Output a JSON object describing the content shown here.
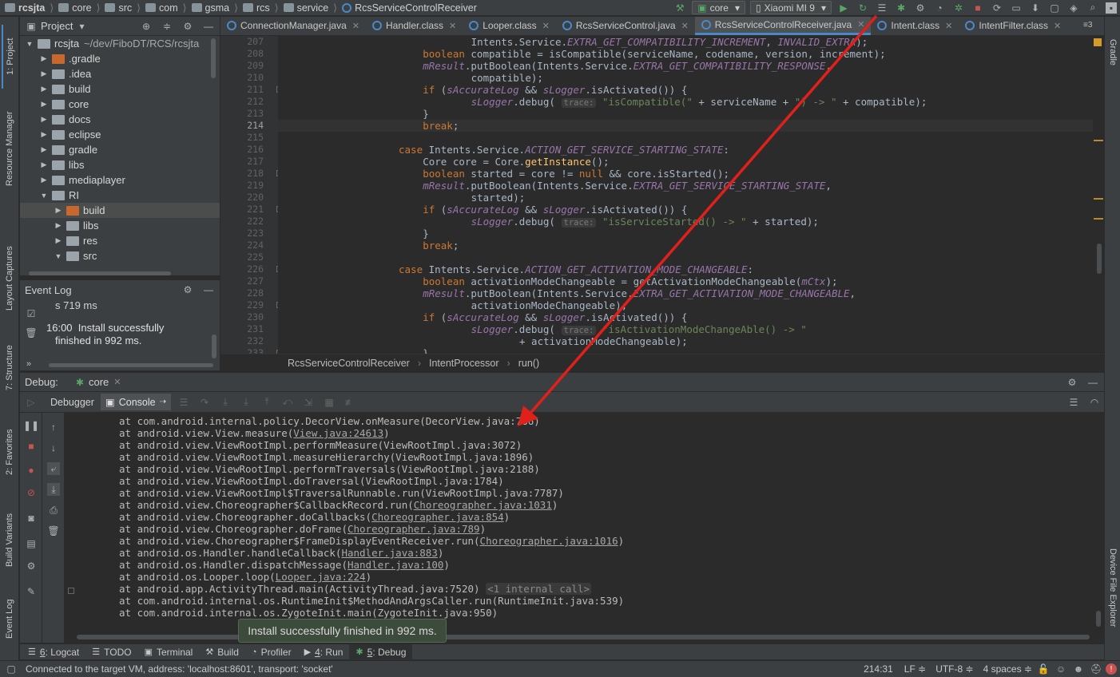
{
  "breadcrumbs": [
    "rcsjta",
    "core",
    "src",
    "com",
    "gsma",
    "rcs",
    "service",
    "RcsServiceControlReceiver"
  ],
  "toolbar": {
    "run_config": "core",
    "device": "Xiaomi MI 9"
  },
  "left_strip": [
    "1: Project",
    "Resource Manager",
    "Layout Captures",
    "7: Structure",
    "2: Favorites",
    "Build Variants",
    "Event Log"
  ],
  "right_strip": [
    "Gradle",
    "Device File Explorer"
  ],
  "project": {
    "header": "Project",
    "tree": [
      {
        "label": "rcsjta",
        "path": "~/dev/FiboDT/RCS/rcsjta",
        "level": 0,
        "open": true
      },
      {
        "label": ".gradle",
        "level": 1,
        "color": "orange"
      },
      {
        "label": ".idea",
        "level": 1
      },
      {
        "label": "build",
        "level": 1
      },
      {
        "label": "core",
        "level": 1
      },
      {
        "label": "docs",
        "level": 1
      },
      {
        "label": "eclipse",
        "level": 1
      },
      {
        "label": "gradle",
        "level": 1
      },
      {
        "label": "libs",
        "level": 1
      },
      {
        "label": "mediaplayer",
        "level": 1
      },
      {
        "label": "RI",
        "level": 1,
        "open": true
      },
      {
        "label": "build",
        "level": 2,
        "color": "orange",
        "selected": true
      },
      {
        "label": "libs",
        "level": 2
      },
      {
        "label": "res",
        "level": 2
      },
      {
        "label": "src",
        "level": 2,
        "open": true
      }
    ]
  },
  "event_log": {
    "header": "Event Log",
    "partial_line": "s 719 ms",
    "time": "16:00",
    "message_line1": "Install successfully",
    "message_line2": "finished in 992 ms."
  },
  "editor_tabs": [
    {
      "label": "ConnectionManager.java",
      "active": false
    },
    {
      "label": "Handler.class",
      "active": false
    },
    {
      "label": "Looper.class",
      "active": false
    },
    {
      "label": "RcsServiceControl.java",
      "active": false
    },
    {
      "label": "RcsServiceControlReceiver.java",
      "active": true
    },
    {
      "label": "Intent.class",
      "active": false
    },
    {
      "label": "IntentFilter.class",
      "active": false
    }
  ],
  "editor_tab_overflow": "3",
  "code": {
    "current_line": 214,
    "lines": [
      {
        "n": 207,
        "indent": 8,
        "parts": [
          [
            "t",
            "Intents.Service."
          ],
          [
            "f",
            "EXTRA_GET_COMPATIBILITY_INCREMENT"
          ],
          [
            "t",
            ", "
          ],
          [
            "f",
            "INVALID_EXTRA"
          ],
          [
            "t",
            ");"
          ]
        ]
      },
      {
        "n": 208,
        "indent": 6,
        "parts": [
          [
            "k",
            "boolean "
          ],
          [
            "t",
            "compatible = isCompatible(serviceName, codename, version, increment);"
          ]
        ]
      },
      {
        "n": 209,
        "indent": 6,
        "parts": [
          [
            "v",
            "mResult"
          ],
          [
            "t",
            ".putBoolean(Intents.Service."
          ],
          [
            "f",
            "EXTRA_GET_COMPATIBILITY_RESPONSE"
          ],
          [
            "t",
            ","
          ]
        ]
      },
      {
        "n": 210,
        "indent": 8,
        "parts": [
          [
            "t",
            "compatible);"
          ]
        ]
      },
      {
        "n": 211,
        "indent": 6,
        "parts": [
          [
            "k",
            "if "
          ],
          [
            "t",
            "("
          ],
          [
            "f",
            "sAccurateLog"
          ],
          [
            "t",
            " && "
          ],
          [
            "f",
            "sLogger"
          ],
          [
            "t",
            ".isActivated()) {"
          ]
        ]
      },
      {
        "n": 212,
        "indent": 8,
        "parts": [
          [
            "f",
            "sLogger"
          ],
          [
            "t",
            ".debug( "
          ],
          [
            "h",
            "trace:"
          ],
          [
            "s",
            " \"isCompatible(\""
          ],
          [
            "t",
            " + serviceName + "
          ],
          [
            "s",
            "\") -> \""
          ],
          [
            "t",
            " + compatible);"
          ]
        ]
      },
      {
        "n": 213,
        "indent": 6,
        "parts": [
          [
            "t",
            "}"
          ]
        ]
      },
      {
        "n": 214,
        "indent": 6,
        "parts": [
          [
            "k",
            "break"
          ],
          [
            "t",
            ";"
          ]
        ]
      },
      {
        "n": 215,
        "indent": 0,
        "parts": []
      },
      {
        "n": 216,
        "indent": 5,
        "parts": [
          [
            "k",
            "case "
          ],
          [
            "t",
            "Intents.Service."
          ],
          [
            "f",
            "ACTION_GET_SERVICE_STARTING_STATE"
          ],
          [
            "t",
            ":"
          ]
        ]
      },
      {
        "n": 217,
        "indent": 6,
        "parts": [
          [
            "t",
            "Core core = Core."
          ],
          [
            "i",
            "getInstance"
          ],
          [
            "t",
            "();"
          ]
        ]
      },
      {
        "n": 218,
        "indent": 6,
        "parts": [
          [
            "k",
            "boolean "
          ],
          [
            "t",
            "started = core != "
          ],
          [
            "k",
            "null "
          ],
          [
            "t",
            "&& core.isStarted();"
          ]
        ]
      },
      {
        "n": 219,
        "indent": 6,
        "parts": [
          [
            "v",
            "mResult"
          ],
          [
            "t",
            ".putBoolean(Intents.Service."
          ],
          [
            "f",
            "EXTRA_GET_SERVICE_STARTING_STATE"
          ],
          [
            "t",
            ","
          ]
        ]
      },
      {
        "n": 220,
        "indent": 8,
        "parts": [
          [
            "t",
            "started);"
          ]
        ]
      },
      {
        "n": 221,
        "indent": 6,
        "parts": [
          [
            "k",
            "if "
          ],
          [
            "t",
            "("
          ],
          [
            "f",
            "sAccurateLog"
          ],
          [
            "t",
            " && "
          ],
          [
            "f",
            "sLogger"
          ],
          [
            "t",
            ".isActivated()) {"
          ]
        ]
      },
      {
        "n": 222,
        "indent": 8,
        "parts": [
          [
            "f",
            "sLogger"
          ],
          [
            "t",
            ".debug( "
          ],
          [
            "h",
            "trace:"
          ],
          [
            "s",
            " \"isServiceStarted() -> \""
          ],
          [
            "t",
            " + started);"
          ]
        ]
      },
      {
        "n": 223,
        "indent": 6,
        "parts": [
          [
            "t",
            "}"
          ]
        ]
      },
      {
        "n": 224,
        "indent": 6,
        "parts": [
          [
            "k",
            "break"
          ],
          [
            "t",
            ";"
          ]
        ]
      },
      {
        "n": 225,
        "indent": 0,
        "parts": []
      },
      {
        "n": 226,
        "indent": 5,
        "parts": [
          [
            "k",
            "case "
          ],
          [
            "t",
            "Intents.Service."
          ],
          [
            "f",
            "ACTION_GET_ACTIVATION_MODE_CHANGEABLE"
          ],
          [
            "t",
            ":"
          ]
        ]
      },
      {
        "n": 227,
        "indent": 6,
        "parts": [
          [
            "k",
            "boolean "
          ],
          [
            "t",
            "activationModeChangeable = getActivationModeChangeable("
          ],
          [
            "v",
            "mCtx"
          ],
          [
            "t",
            ");"
          ]
        ]
      },
      {
        "n": 228,
        "indent": 6,
        "parts": [
          [
            "v",
            "mResult"
          ],
          [
            "t",
            ".putBoolean(Intents.Service."
          ],
          [
            "f",
            "EXTRA_GET_ACTIVATION_MODE_CHANGEABLE"
          ],
          [
            "t",
            ","
          ]
        ]
      },
      {
        "n": 229,
        "indent": 8,
        "parts": [
          [
            "t",
            "activationModeChangeable);"
          ]
        ]
      },
      {
        "n": 230,
        "indent": 6,
        "parts": [
          [
            "k",
            "if "
          ],
          [
            "t",
            "("
          ],
          [
            "f",
            "sAccurateLog"
          ],
          [
            "t",
            " && "
          ],
          [
            "f",
            "sLogger"
          ],
          [
            "t",
            ".isActivated()) {"
          ]
        ]
      },
      {
        "n": 231,
        "indent": 8,
        "parts": [
          [
            "f",
            "sLogger"
          ],
          [
            "t",
            ".debug( "
          ],
          [
            "h",
            "trace:"
          ],
          [
            "s",
            " \"isActivationModeChangeAble() -> \""
          ]
        ]
      },
      {
        "n": 232,
        "indent": 10,
        "parts": [
          [
            "t",
            "+ activationModeChangeable);"
          ]
        ]
      },
      {
        "n": 233,
        "indent": 6,
        "parts": [
          [
            "t",
            "}"
          ]
        ]
      }
    ]
  },
  "editor_breadcrumb": [
    "RcsServiceControlReceiver",
    "IntentProcessor",
    "run()"
  ],
  "debug": {
    "label": "Debug:",
    "session": "core",
    "tabs": [
      "Debugger",
      "Console"
    ]
  },
  "console": [
    {
      "parts": [
        [
          "t",
          "at com.android.internal.policy.DecorView.onMeasure(DecorView.java:766)"
        ]
      ]
    },
    {
      "parts": [
        [
          "t",
          "at android.view.View.measure("
        ],
        [
          "l",
          "View.java:24613"
        ],
        [
          "t",
          ")"
        ]
      ]
    },
    {
      "parts": [
        [
          "t",
          "at android.view.ViewRootImpl.performMeasure(ViewRootImpl.java:3072)"
        ]
      ]
    },
    {
      "parts": [
        [
          "t",
          "at android.view.ViewRootImpl.measureHierarchy(ViewRootImpl.java:1896)"
        ]
      ]
    },
    {
      "parts": [
        [
          "t",
          "at android.view.ViewRootImpl.performTraversals(ViewRootImpl.java:2188)"
        ]
      ]
    },
    {
      "parts": [
        [
          "t",
          "at android.view.ViewRootImpl.doTraversal(ViewRootImpl.java:1784)"
        ]
      ]
    },
    {
      "parts": [
        [
          "t",
          "at android.view.ViewRootImpl$TraversalRunnable.run(ViewRootImpl.java:7787)"
        ]
      ]
    },
    {
      "parts": [
        [
          "t",
          "at android.view.Choreographer$CallbackRecord.run("
        ],
        [
          "l",
          "Choreographer.java:1031"
        ],
        [
          "t",
          ")"
        ]
      ]
    },
    {
      "parts": [
        [
          "t",
          "at android.view.Choreographer.doCallbacks("
        ],
        [
          "l",
          "Choreographer.java:854"
        ],
        [
          "t",
          ")"
        ]
      ]
    },
    {
      "parts": [
        [
          "t",
          "at android.view.Choreographer.doFrame("
        ],
        [
          "l",
          "Choreographer.java:789"
        ],
        [
          "t",
          ")"
        ]
      ]
    },
    {
      "parts": [
        [
          "t",
          "at android.view.Choreographer$FrameDisplayEventReceiver.run("
        ],
        [
          "l",
          "Choreographer.java:1016"
        ],
        [
          "t",
          ")"
        ]
      ]
    },
    {
      "parts": [
        [
          "t",
          "at android.os.Handler.handleCallback("
        ],
        [
          "l",
          "Handler.java:883"
        ],
        [
          "t",
          ")"
        ]
      ]
    },
    {
      "parts": [
        [
          "t",
          "at android.os.Handler.dispatchMessage("
        ],
        [
          "l",
          "Handler.java:100"
        ],
        [
          "t",
          ")"
        ]
      ]
    },
    {
      "parts": [
        [
          "t",
          "at android.os.Looper.loop("
        ],
        [
          "l",
          "Looper.java:224"
        ],
        [
          "t",
          ")"
        ]
      ]
    },
    {
      "parts": [
        [
          "t",
          "at android.app.ActivityThread.main(ActivityThread.java:7520) "
        ],
        [
          "g",
          "<1 internal call>"
        ]
      ]
    },
    {
      "parts": [
        [
          "t",
          "at com.android.internal.os.RuntimeInit$MethodAndArgsCaller.run(RuntimeInit.java:539)"
        ]
      ]
    },
    {
      "parts": [
        [
          "t",
          "at com.android.internal.os.ZygoteInit.main(ZygoteInit.java:950)"
        ]
      ]
    }
  ],
  "toast": "Install successfully finished in 992 ms.",
  "bottom_tabs": [
    {
      "num": "6",
      "label": ": Logcat",
      "icon": "logcat-icon"
    },
    {
      "num": "",
      "label": "TODO",
      "icon": "list-icon"
    },
    {
      "num": "",
      "label": "Terminal",
      "icon": "terminal-icon"
    },
    {
      "num": "",
      "label": "Build",
      "icon": "hammer-icon"
    },
    {
      "num": "",
      "label": "Profiler",
      "icon": "gauge-icon"
    },
    {
      "num": "4",
      "label": ": Run",
      "icon": "run-icon"
    },
    {
      "num": "5",
      "label": ": Debug",
      "icon": "bug-icon",
      "active": true
    }
  ],
  "status": {
    "message": "Connected to the target VM, address: 'localhost:8601', transport: 'socket'",
    "position": "214:31",
    "line_sep": "LF ≑",
    "encoding": "UTF-8 ≑",
    "indent": "4 spaces ≑"
  },
  "colors": {
    "accent": "#4a88c7",
    "annotation_arrow": "#e0201b",
    "run_green": "#59a869",
    "stop_red": "#c75450"
  }
}
